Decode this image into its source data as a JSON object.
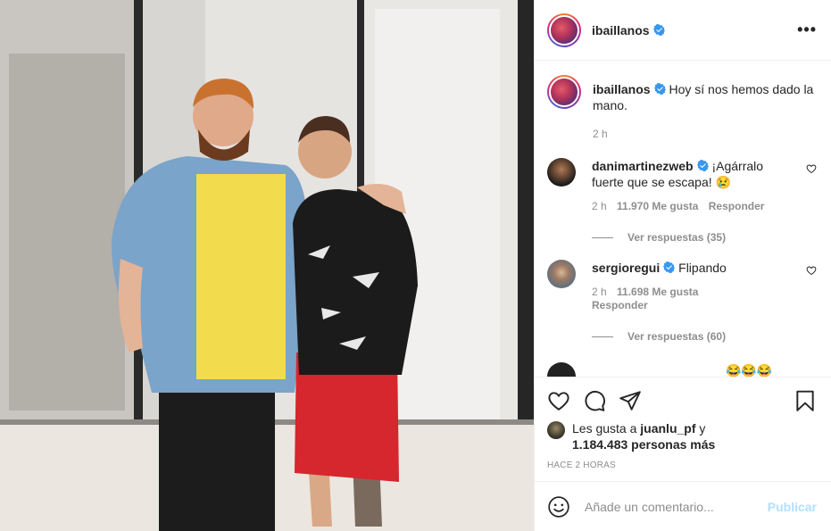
{
  "post": {
    "author": "ibaillanos",
    "caption_text": "Hoy sí nos hemos dado la mano.",
    "caption_time": "2 h",
    "more_icon": "more-horizontal-icon"
  },
  "comments": [
    {
      "username": "danimartinezweb",
      "text": "¡Agárralo fuerte que se escapa! 😢",
      "time": "2 h",
      "likes": "11.970 Me gusta",
      "reply": "Responder",
      "replies": "Ver respuestas (35)"
    },
    {
      "username": "sergioregui",
      "text": "Flipando",
      "time": "2 h",
      "likes": "11.698 Me gusta",
      "reply": "Responder",
      "replies": "Ver respuestas (60)"
    },
    {
      "username": "",
      "text": "😂😂😂"
    }
  ],
  "actions": {
    "likes_prefix": "Les gusta a",
    "likes_user": "juanlu_pf",
    "likes_mid": "y",
    "likes_count": "1.184.483 personas más",
    "posted": "HACE 2 HORAS"
  },
  "comment_box": {
    "placeholder": "Añade un comentario...",
    "publish": "Publicar"
  },
  "colors": {
    "verified": "#3897f0",
    "publish_disabled": "#b2dffc"
  }
}
